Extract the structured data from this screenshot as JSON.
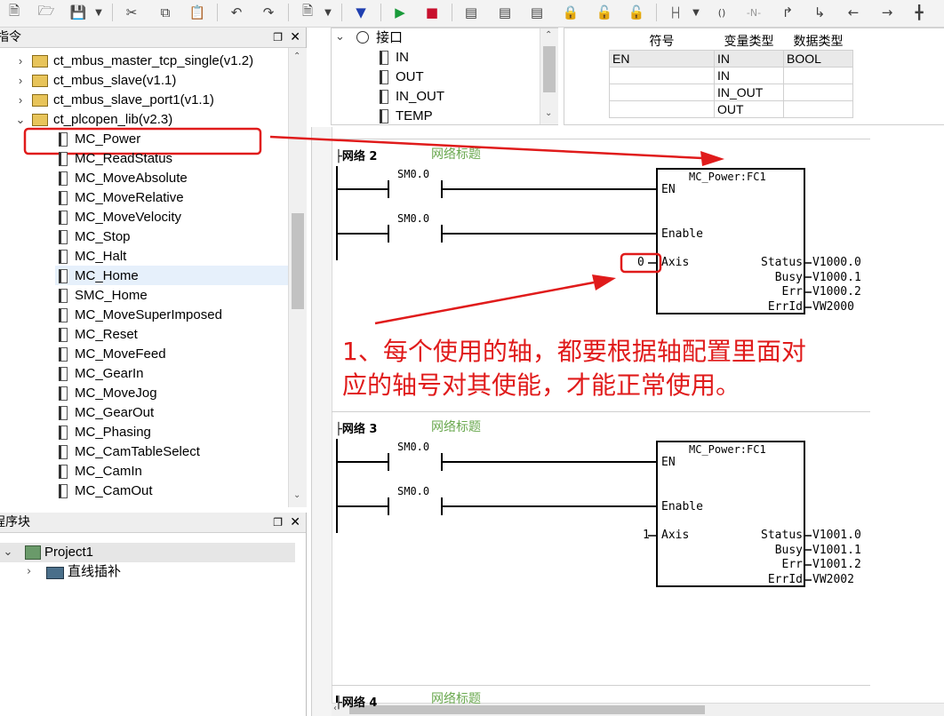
{
  "toolbar": {
    "icons": [
      "new-file-icon",
      "open-folder-icon",
      "save-icon",
      "dropdown-icon",
      "cut-icon",
      "copy-icon",
      "paste-icon",
      "undo-icon",
      "redo-icon",
      "compile-icon",
      "dropdown-icon",
      "download-icon",
      "run-icon",
      "stop-icon",
      "insert-network-icon",
      "delete-network-icon",
      "insert-row-icon",
      "lock-icon",
      "unlock-icon",
      "lock-blue-icon",
      "insert-contact-icon",
      "dropdown-icon",
      "insert-coil-icon",
      "negate-contact-icon",
      "line-up-icon",
      "line-down-icon",
      "line-left-icon",
      "line-right-icon",
      "parallel-icon"
    ]
  },
  "instructions_panel": {
    "title": "指令",
    "items": [
      {
        "label": "ct_mbus_master_tcp_single(v1.2)",
        "type": "lib",
        "expanded": false
      },
      {
        "label": "ct_mbus_slave(v1.1)",
        "type": "lib",
        "expanded": false
      },
      {
        "label": "ct_mbus_slave_port1(v1.1)",
        "type": "lib",
        "expanded": false
      },
      {
        "label": "ct_plcopen_lib(v2.3)",
        "type": "lib",
        "expanded": true
      },
      {
        "label": "MC_Power",
        "type": "fb"
      },
      {
        "label": "MC_ReadStatus",
        "type": "fb"
      },
      {
        "label": "MC_MoveAbsolute",
        "type": "fb"
      },
      {
        "label": "MC_MoveRelative",
        "type": "fb"
      },
      {
        "label": "MC_MoveVelocity",
        "type": "fb"
      },
      {
        "label": "MC_Stop",
        "type": "fb"
      },
      {
        "label": "MC_Halt",
        "type": "fb"
      },
      {
        "label": "MC_Home",
        "type": "fb"
      },
      {
        "label": "SMC_Home",
        "type": "fb"
      },
      {
        "label": "MC_MoveSuperImposed",
        "type": "fb"
      },
      {
        "label": "MC_Reset",
        "type": "fb"
      },
      {
        "label": "MC_MoveFeed",
        "type": "fb"
      },
      {
        "label": "MC_GearIn",
        "type": "fb"
      },
      {
        "label": "MC_MoveJog",
        "type": "fb"
      },
      {
        "label": "MC_GearOut",
        "type": "fb"
      },
      {
        "label": "MC_Phasing",
        "type": "fb"
      },
      {
        "label": "MC_CamTableSelect",
        "type": "fb"
      },
      {
        "label": "MC_CamIn",
        "type": "fb"
      },
      {
        "label": "MC_CamOut",
        "type": "fb"
      }
    ]
  },
  "program_panel": {
    "title": "程序块",
    "root": "Project1",
    "child": "直线插补"
  },
  "interface_tree": {
    "root": "接口",
    "items": [
      "IN",
      "OUT",
      "IN_OUT",
      "TEMP"
    ]
  },
  "var_table": {
    "headers": [
      "符号",
      "变量类型",
      "数据类型"
    ],
    "rows": [
      [
        "EN",
        "IN",
        "BOOL"
      ],
      [
        "",
        "IN",
        ""
      ],
      [
        "",
        "IN_OUT",
        ""
      ],
      [
        "",
        "OUT",
        ""
      ]
    ]
  },
  "networks": [
    {
      "label": "网络 2",
      "subtitle": "网络标题",
      "contact1": "SM0.0",
      "contact2": "SM0.0",
      "block_title": "MC_Power:FC1",
      "in_en": "EN",
      "in_enable": "Enable",
      "in_axis": "Axis",
      "axis_value": "0",
      "outputs": [
        {
          "pin": "Status",
          "addr": "V1000.0"
        },
        {
          "pin": "Busy",
          "addr": "V1000.1"
        },
        {
          "pin": "Err",
          "addr": "V1000.2"
        },
        {
          "pin": "ErrId",
          "addr": "VW2000"
        }
      ]
    },
    {
      "label": "网络 3",
      "subtitle": "网络标题",
      "contact1": "SM0.0",
      "contact2": "SM0.0",
      "block_title": "MC_Power:FC1",
      "in_en": "EN",
      "in_enable": "Enable",
      "in_axis": "Axis",
      "axis_value": "1",
      "outputs": [
        {
          "pin": "Status",
          "addr": "V1001.0"
        },
        {
          "pin": "Busy",
          "addr": "V1001.1"
        },
        {
          "pin": "Err",
          "addr": "V1001.2"
        },
        {
          "pin": "ErrId",
          "addr": "VW2002"
        }
      ]
    },
    {
      "label": "网络 4",
      "subtitle": "网络标题"
    }
  ],
  "annotation": {
    "line1": "1、每个使用的轴，都要根据轴配置里面对",
    "line2": "应的轴号对其使能，才能正常使用。",
    "color": "#e01b1b"
  }
}
